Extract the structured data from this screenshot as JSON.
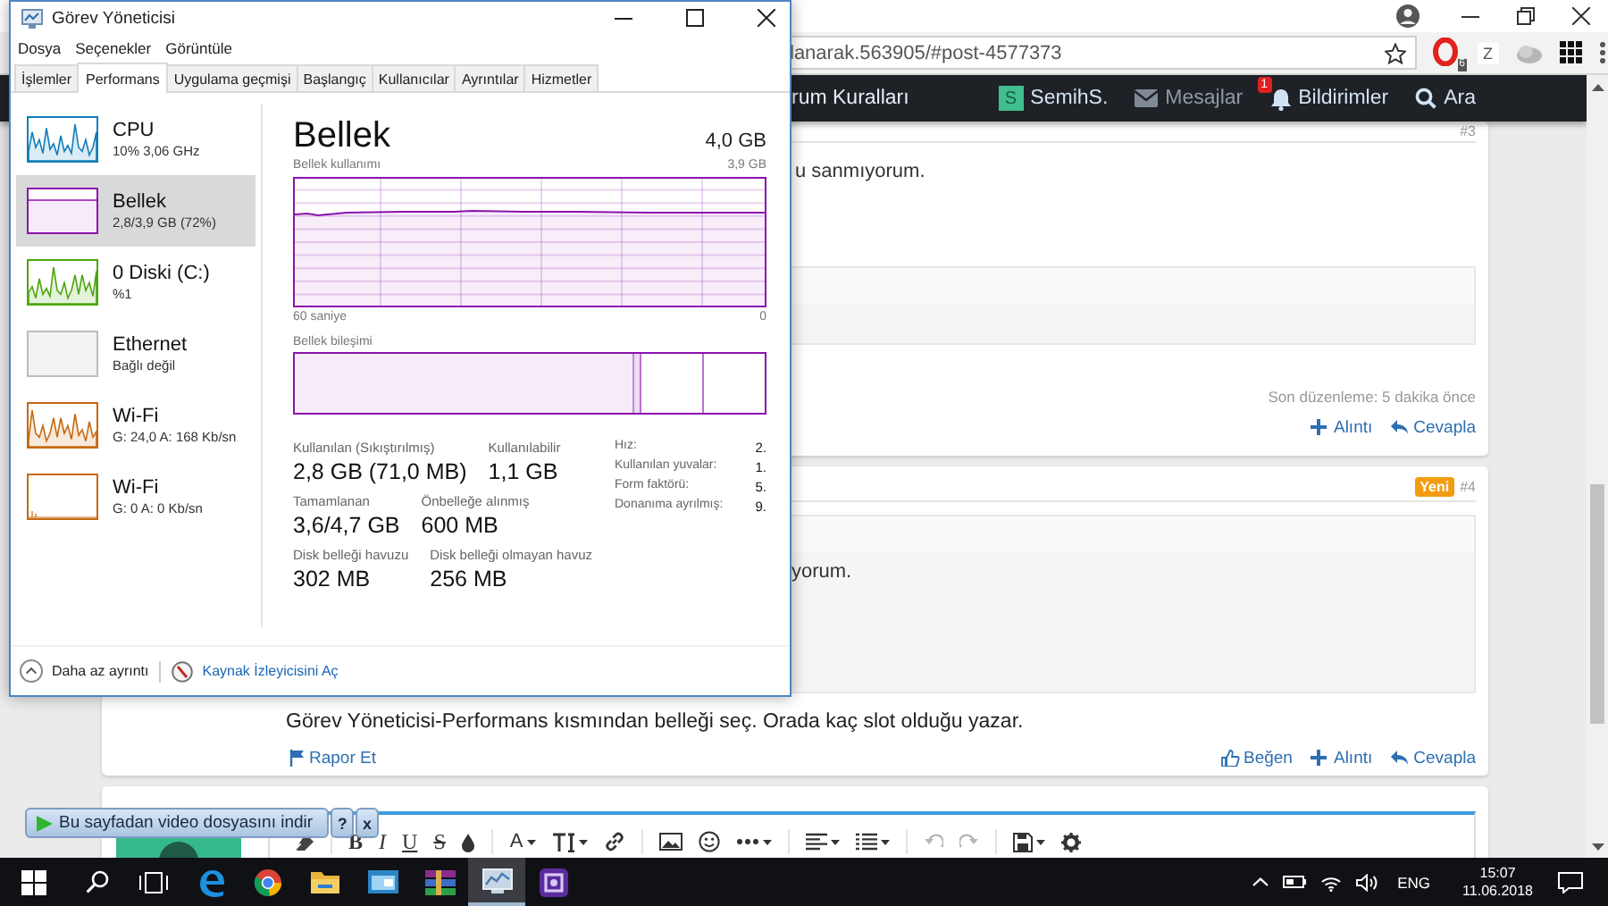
{
  "browser": {
    "url": "lanarak.563905/#post-4577373",
    "opera_badge": "6",
    "extension_letter": "Z",
    "nav": {
      "link": "rum Kuralları",
      "avatar_letter": "S",
      "user": "SemihS.",
      "messages": "Mesajlar",
      "alerts_count": "1",
      "alerts": "Bildirimler",
      "search": "Ara"
    },
    "posts": [
      {
        "number": "#3",
        "lead": "u sanmıyorum.",
        "edited": "Son düzenleme: 5 dakika önce",
        "actions": [
          {
            "kind": "quote",
            "label": "Alıntı"
          },
          {
            "kind": "reply",
            "label": "Cevapla"
          }
        ]
      },
      {
        "badge": "Yeni",
        "number": "#4",
        "quote": "yorum.",
        "text": "Görev Yöneticisi-Performans kısmından belleği seç. Orada kaç slot olduğu yazar.",
        "report": "Rapor Et",
        "actions": [
          {
            "kind": "like",
            "label": "Beğen"
          },
          {
            "kind": "quote",
            "label": "Alıntı"
          },
          {
            "kind": "reply",
            "label": "Cevapla"
          }
        ]
      }
    ],
    "editor": {
      "tools": [
        {
          "kind": "eraser",
          "disabled": false
        },
        {
          "kind": "bold",
          "label": "B",
          "disabled": false
        },
        {
          "kind": "italic",
          "label": "I",
          "disabled": false
        },
        {
          "kind": "underline",
          "label": "U",
          "disabled": false
        },
        {
          "kind": "strike",
          "label": "S",
          "disabled": false
        },
        {
          "kind": "drop",
          "disabled": false
        },
        {
          "kind": "color",
          "label": "A",
          "caret": true,
          "disabled": false
        },
        {
          "kind": "size",
          "caret": true,
          "disabled": false
        },
        {
          "kind": "link",
          "disabled": false
        },
        {
          "kind": "image",
          "disabled": false
        },
        {
          "kind": "smiley",
          "disabled": false
        },
        {
          "kind": "more",
          "caret": true,
          "disabled": false
        },
        {
          "kind": "align",
          "caret": true,
          "disabled": false
        },
        {
          "kind": "list",
          "caret": true,
          "disabled": false
        },
        {
          "kind": "undo",
          "disabled": true
        },
        {
          "kind": "redo",
          "disabled": true
        },
        {
          "kind": "save",
          "caret": true,
          "disabled": false
        },
        {
          "kind": "gear",
          "disabled": false
        }
      ]
    }
  },
  "download_bar": {
    "label": "Bu sayfadan video dosyasını indir",
    "help": "?",
    "close": "x"
  },
  "task_manager": {
    "title": "Görev Yöneticisi",
    "menu": [
      "Dosya",
      "Seçenekler",
      "Görüntüle"
    ],
    "tabs": [
      {
        "label": "İşlemler",
        "selected": false
      },
      {
        "label": "Performans",
        "selected": true
      },
      {
        "label": "Uygulama geçmişi",
        "selected": false
      },
      {
        "label": "Başlangıç",
        "selected": false
      },
      {
        "label": "Kullanıcılar",
        "selected": false
      },
      {
        "label": "Ayrıntılar",
        "selected": false
      },
      {
        "label": "Hizmetler",
        "selected": false
      }
    ],
    "sidebar": [
      {
        "kind": "cpu",
        "name": "CPU",
        "detail": "10% 3,06 GHz",
        "selected": false,
        "active": true,
        "color": "#117dbb"
      },
      {
        "kind": "memory",
        "name": "Bellek",
        "detail": "2,8/3,9 GB (72%)",
        "selected": true,
        "active": false,
        "color": "#8b12ae"
      },
      {
        "kind": "disk",
        "name": "0 Diski (C:)",
        "detail": "%1",
        "selected": false,
        "active": true,
        "color": "#4da60c"
      },
      {
        "kind": "ethernet",
        "name": "Ethernet",
        "detail": "Bağlı değil",
        "selected": false,
        "active": false,
        "color": "#bcbcbc"
      },
      {
        "kind": "wifi",
        "name": "Wi-Fi",
        "detail": "G: 24,0 A: 168 Kb/sn",
        "selected": false,
        "active": true,
        "color": "#c6690f"
      },
      {
        "kind": "wifi",
        "name": "Wi-Fi",
        "detail": "G: 0 A: 0 Kb/sn",
        "selected": false,
        "active": false,
        "color": "#c6690f"
      }
    ],
    "detail": {
      "title": "Bellek",
      "capacity": "4,0 GB",
      "graph_label": "Bellek kullanımı",
      "graph_max": "3,9 GB",
      "graph_span": "60 saniye",
      "graph_min": "0",
      "composition_label": "Bellek bileşimi",
      "stat_rows": [
        {
          "stats": [
            {
              "label": "Kullanılan (Sıkıştırılmış)",
              "value": "2,8 GB (71,0 MB)"
            },
            {
              "label": "Kullanılabilir",
              "value": "1,1 GB"
            }
          ]
        },
        {
          "stats": [
            {
              "label": "Tamamlanan",
              "value": "3,6/4,7 GB"
            },
            {
              "label": "Önbelleğe alınmış",
              "value": "600 MB"
            }
          ]
        },
        {
          "stats": [
            {
              "label": "Disk belleği havuzu",
              "value": "302 MB"
            },
            {
              "label": "Disk belleği olmayan havuz",
              "value": "256 MB"
            }
          ]
        }
      ],
      "specs": [
        {
          "label": "Hız:",
          "value": "2."
        },
        {
          "label": "Kullanılan yuvalar:",
          "value": "1."
        },
        {
          "label": "Form faktörü:",
          "value": "5."
        },
        {
          "label": "Donanıma ayrılmış:",
          "value": "9."
        }
      ]
    },
    "footer": {
      "less_details": "Daha az ayrıntı",
      "resource_monitor": "Kaynak İzleyicisini Aç"
    }
  },
  "taskbar": {
    "apps": [
      {
        "kind": "edge",
        "active": false
      },
      {
        "kind": "chrome",
        "active": false
      },
      {
        "kind": "folder",
        "active": false
      },
      {
        "kind": "window",
        "active": false
      },
      {
        "kind": "books",
        "active": false
      },
      {
        "kind": "monitor",
        "active": true
      },
      {
        "kind": "purple",
        "active": false
      }
    ],
    "language": "ENG",
    "time": "15:07",
    "date": "11.06.2018"
  }
}
